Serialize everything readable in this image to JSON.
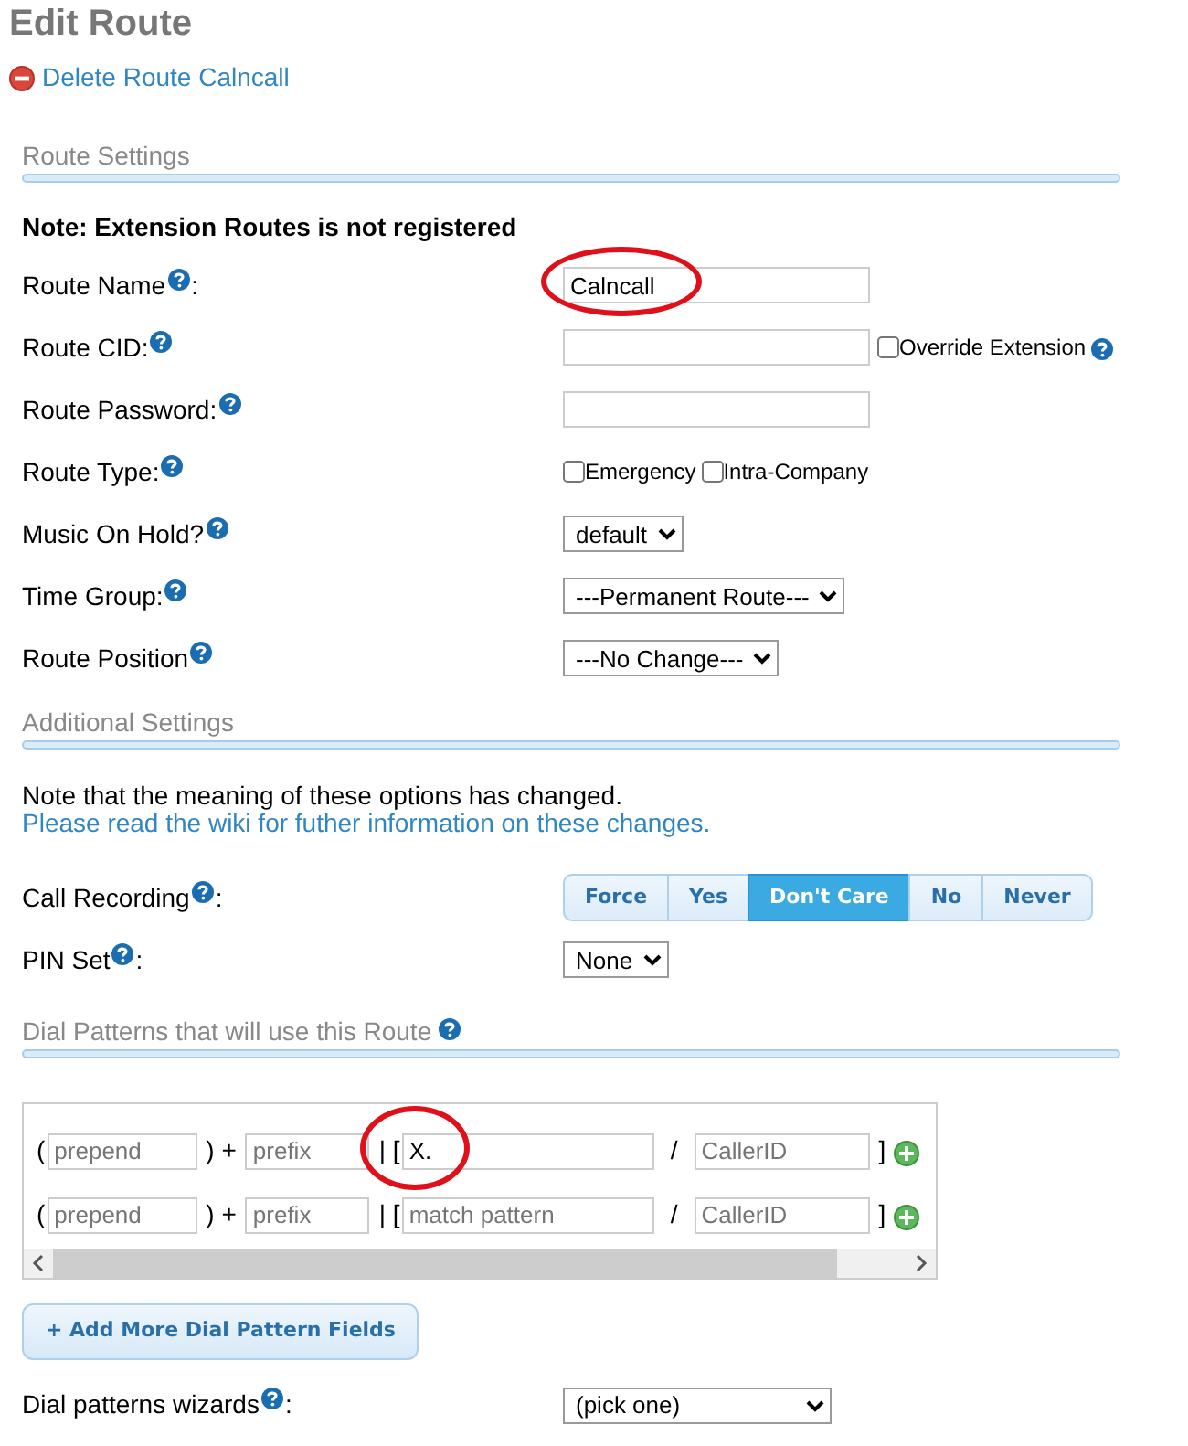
{
  "title": "Edit Route",
  "delete_link": "Delete Route Calncall",
  "route_settings": {
    "heading": "Route Settings",
    "note": "Note: Extension Routes is not registered",
    "fields": [
      {
        "kind": "text",
        "label": "Route Name",
        "suffix": ":",
        "value": "Calncall",
        "circled": true
      },
      {
        "kind": "text",
        "label": "Route CID:",
        "options": [
          {
            "label": "Override Extension",
            "checked": false
          }
        ],
        "option_help": true
      },
      {
        "kind": "text",
        "label": "Route Password:"
      },
      {
        "kind": "checkboxes",
        "label": "Route Type:",
        "options": [
          {
            "label": "Emergency",
            "checked": false
          },
          {
            "label": "Intra-Company",
            "checked": false
          }
        ]
      },
      {
        "kind": "select",
        "label": "Music On Hold?",
        "value": "default"
      },
      {
        "kind": "select",
        "label": "Time Group:",
        "value": "---Permanent Route---"
      },
      {
        "kind": "select",
        "label": "Route Position",
        "value": "---No Change---"
      }
    ]
  },
  "additional_settings": {
    "heading": "Additional Settings",
    "note": "Note that the meaning of these options has changed.",
    "note_link": "Please read the wiki for futher information on these changes.",
    "fields": [
      {
        "kind": "buttons",
        "label": "Call Recording",
        "suffix": ":",
        "options": [
          {
            "label": "Force",
            "selected": false
          },
          {
            "label": "Yes",
            "selected": false
          },
          {
            "label": "Don't Care",
            "selected": true
          },
          {
            "label": "No",
            "selected": false
          },
          {
            "label": "Never",
            "selected": false
          }
        ]
      },
      {
        "kind": "select",
        "label": "PIN Set",
        "suffix": ":",
        "value": "None"
      }
    ]
  },
  "dial_patterns": {
    "heading": "Dial Patterns that will use this Route",
    "rows": [
      {
        "separators": [
          "(",
          ") +",
          "| [",
          "/",
          "]"
        ],
        "prepend": {
          "placeholder": "prepend"
        },
        "prefix": {
          "placeholder": "prefix"
        },
        "match": {
          "value": "X.",
          "circled": true
        },
        "callerid": {
          "placeholder": "CallerID"
        }
      },
      {
        "separators": [
          "(",
          ") +",
          "| [",
          "/",
          "]"
        ],
        "prepend": {
          "placeholder": "prepend"
        },
        "prefix": {
          "placeholder": "prefix"
        },
        "match": {
          "placeholder": "match pattern"
        },
        "callerid": {
          "placeholder": "CallerID"
        }
      }
    ],
    "add_button": "+ Add More Dial Pattern Fields",
    "wizard": {
      "label": "Dial patterns wizards",
      "suffix": ":",
      "value": "(pick one)"
    }
  }
}
